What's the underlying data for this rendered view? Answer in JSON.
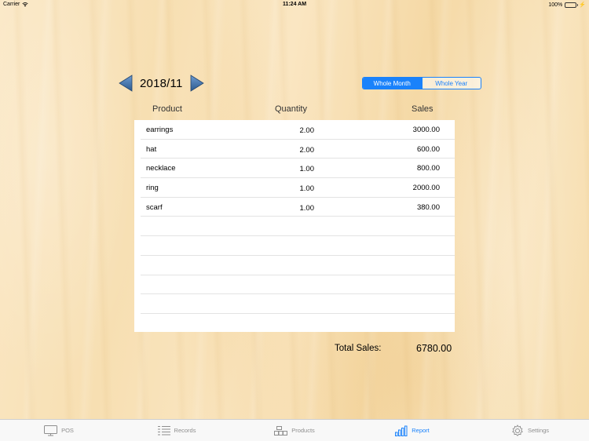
{
  "status_bar": {
    "carrier": "Carrier",
    "time": "11:24 AM",
    "battery": "100%"
  },
  "report": {
    "period": "2018/11",
    "segments": [
      {
        "label": "Whole Month",
        "selected": true
      },
      {
        "label": "Whole Year",
        "selected": false
      }
    ],
    "columns": {
      "product": "Product",
      "quantity": "Quantity",
      "sales": "Sales"
    },
    "rows": [
      {
        "product": "earrings",
        "quantity": "2.00",
        "sales": "3000.00"
      },
      {
        "product": "hat",
        "quantity": "2.00",
        "sales": "600.00"
      },
      {
        "product": "necklace",
        "quantity": "1.00",
        "sales": "800.00"
      },
      {
        "product": "ring",
        "quantity": "1.00",
        "sales": "2000.00"
      },
      {
        "product": "scarf",
        "quantity": "1.00",
        "sales": "380.00"
      },
      {
        "product": "",
        "quantity": "",
        "sales": ""
      },
      {
        "product": "",
        "quantity": "",
        "sales": ""
      },
      {
        "product": "",
        "quantity": "",
        "sales": ""
      },
      {
        "product": "",
        "quantity": "",
        "sales": ""
      },
      {
        "product": "",
        "quantity": "",
        "sales": ""
      }
    ],
    "total_label": "Total Sales:",
    "total_value": "6780.00"
  },
  "tab_bar": {
    "tabs": [
      {
        "label": "POS",
        "icon": "monitor-icon"
      },
      {
        "label": "Records",
        "icon": "list-icon"
      },
      {
        "label": "Products",
        "icon": "boxes-icon"
      },
      {
        "label": "Report",
        "icon": "bar-chart-icon",
        "active": true
      },
      {
        "label": "Settings",
        "icon": "gear-icon"
      }
    ]
  },
  "colors": {
    "accent": "#1a82fb",
    "arrow": "#3a6ea5"
  }
}
